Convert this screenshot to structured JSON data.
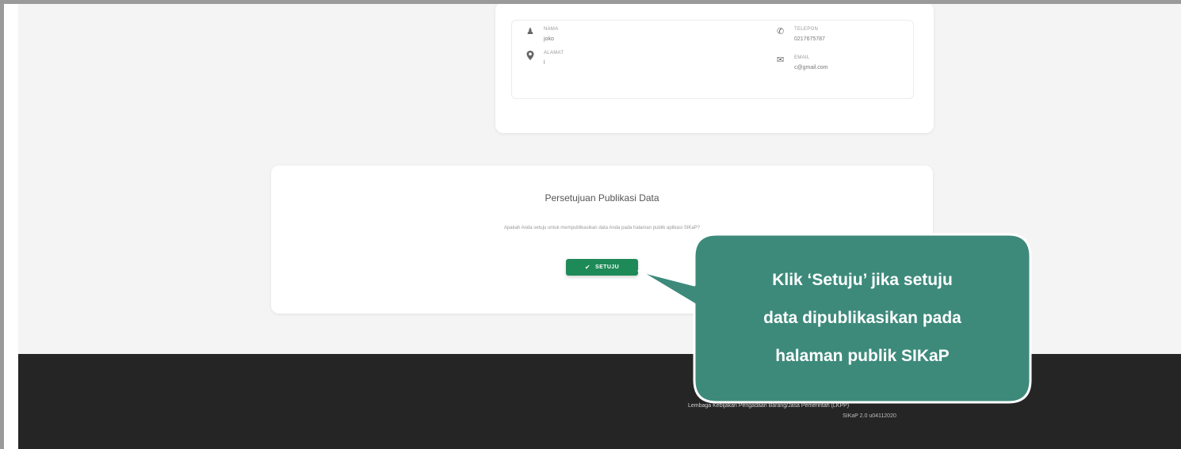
{
  "contact": {
    "nama_label": "NAMA",
    "nama_value": "joko",
    "alamat_label": "ALAMAT",
    "alamat_value": "l",
    "telepon_label": "TELEPON",
    "telepon_value": "0217675787",
    "email_label": "EMAIL",
    "email_value": "c@gmail.com"
  },
  "consent": {
    "title": "Persetujuan Publikasi Data",
    "description": "Apakah Anda setuju untuk mempublikasikan data Anda pada halaman publik aplikasi SIKaP?",
    "button_label": "SETUJU"
  },
  "footer": {
    "line1": "Lembaga Kebijakan Pengadaan Barang/Jasa Pemerintah (LKPP)",
    "line2": "SIKaP 2.0 u04112020"
  },
  "callout": {
    "line1": "Klik ‘Setuju’ jika setuju",
    "line2": "data dipublikasikan pada",
    "line3": "halaman publik SIKaP"
  },
  "colors": {
    "accent_green": "#1e8a58",
    "callout_teal": "#3d8a7b",
    "footer_bg": "#252525"
  }
}
